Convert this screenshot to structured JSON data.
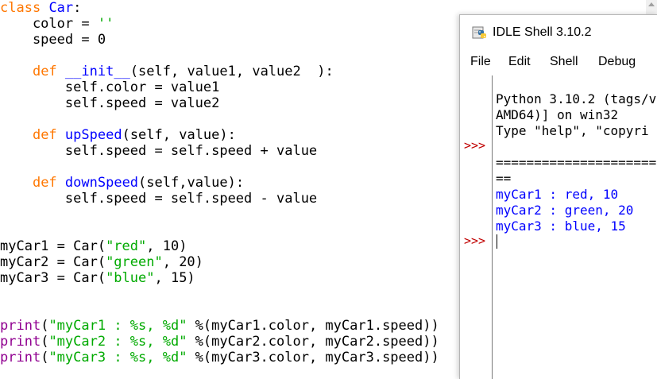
{
  "editor": {
    "lines": [
      "class Car:",
      "    color = ''",
      "    speed = 0",
      "",
      "    def __init__(self, value1, value2  ):",
      "        self.color = value1",
      "        self.speed = value2",
      "",
      "    def upSpeed(self, value):",
      "        self.speed = self.speed + value",
      "",
      "    def downSpeed(self,value):",
      "        self.speed = self.speed - value",
      "",
      "",
      "myCar1 = Car(\"red\", 10)",
      "myCar2 = Car(\"green\", 20)",
      "myCar3 = Car(\"blue\", 15)",
      "",
      "",
      "print(\"myCar1 : %s, %d\" %(myCar1.color, myCar1.speed))",
      "print(\"myCar2 : %s, %d\" %(myCar2.color, myCar2.speed))",
      "print(\"myCar3 : %s, %d\" %(myCar3.color, myCar3.speed))"
    ],
    "tokens": {
      "kw_class": "class",
      "class_name": "Car",
      "kw_def": "def",
      "init_name": "__init__",
      "up_name": "upSpeed",
      "down_name": "downSpeed",
      "print_kw": "print"
    }
  },
  "shell": {
    "title": "IDLE Shell 3.10.2",
    "icon": "python-icon",
    "menu": [
      "File",
      "Edit",
      "Shell",
      "Debug"
    ],
    "prompt_symbol": ">>>",
    "banner": [
      "Python 3.10.2 (tags/v",
      "AMD64)] on win32",
      "Type \"help\", \"copyri"
    ],
    "restart_line": "=====================",
    "restart_cont": "==",
    "output": [
      "myCar1 : red, 10",
      "myCar2 : green, 20",
      "myCar3 : blue, 15"
    ]
  },
  "colors": {
    "keyword": "#ff7700",
    "definition": "#0000ff",
    "string": "#00aa00",
    "builtin": "#900090",
    "shell_output": "#0000ff",
    "prompt": "#c00000"
  }
}
